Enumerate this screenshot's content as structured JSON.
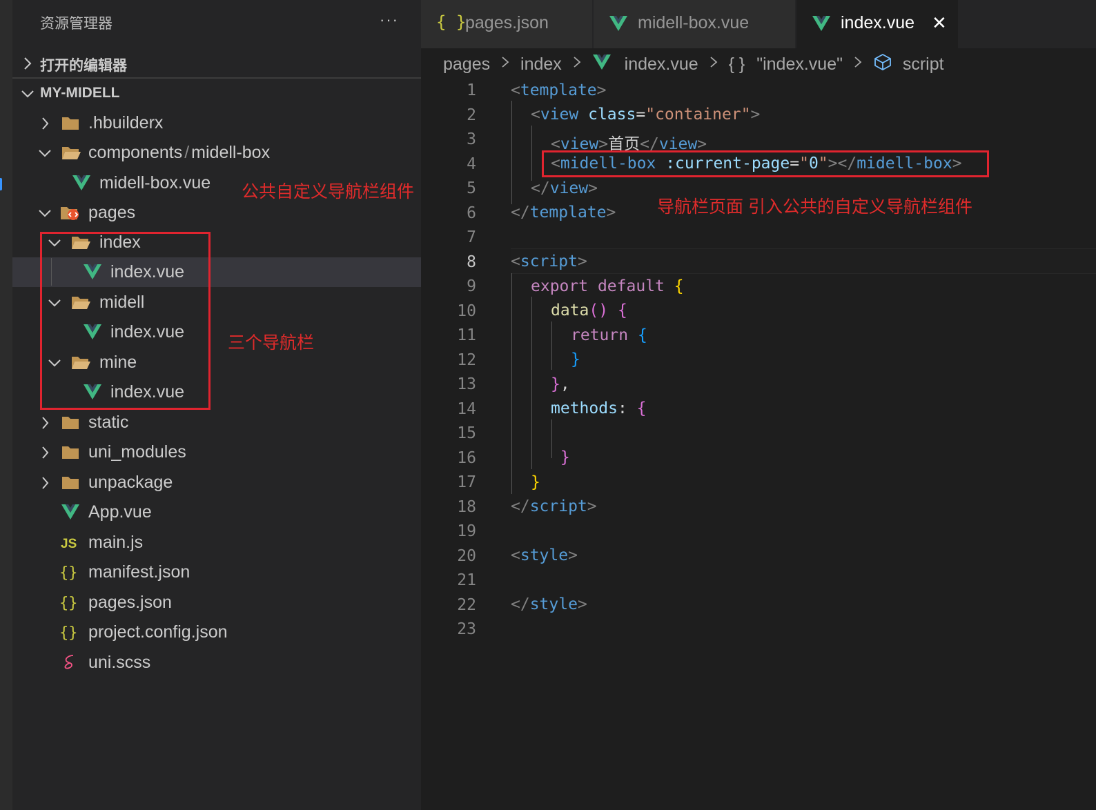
{
  "explorer": {
    "title": "资源管理器",
    "more": "···",
    "open_editors": "打开的编辑器",
    "project": "MY-MIDELL",
    "tree": [
      {
        "label": ".hbuilderx"
      },
      {
        "label": "components",
        "sep": "/",
        "label2": "midell-box"
      },
      {
        "label": "midell-box.vue"
      },
      {
        "label": "pages"
      },
      {
        "label": "index"
      },
      {
        "label": "index.vue"
      },
      {
        "label": "midell"
      },
      {
        "label": "index.vue"
      },
      {
        "label": "mine"
      },
      {
        "label": "index.vue"
      },
      {
        "label": "static"
      },
      {
        "label": "uni_modules"
      },
      {
        "label": "unpackage"
      },
      {
        "label": "App.vue"
      },
      {
        "label": "main.js"
      },
      {
        "label": "manifest.json"
      },
      {
        "label": "pages.json"
      },
      {
        "label": "project.config.json"
      },
      {
        "label": "uni.scss"
      }
    ]
  },
  "annotations": {
    "component": "公共自定义导航栏组件",
    "three_nav": "三个导航栏",
    "nav_page": "导航栏页面 引入公共的自定义导航栏组件"
  },
  "tabs": [
    {
      "label": "pages.json",
      "icon": "{ }"
    },
    {
      "label": "midell-box.vue",
      "icon": "V"
    },
    {
      "label": "index.vue",
      "icon": "V",
      "active": true,
      "close": "✕"
    }
  ],
  "breadcrumb": {
    "pages": "pages",
    "index": "index",
    "file": "index.vue",
    "obj_icon": "{ }",
    "obj": "\"index.vue\"",
    "script": "script"
  },
  "editor": {
    "current_line": 8,
    "line_numbers": [
      "1",
      "2",
      "3",
      "4",
      "5",
      "6",
      "7",
      "8",
      "9",
      "10",
      "11",
      "12",
      "13",
      "14",
      "15",
      "16",
      "17",
      "18",
      "19",
      "20",
      "21",
      "22",
      "23"
    ],
    "code": {
      "l3_text": "首页",
      "l4_value": "0"
    }
  },
  "colors": {
    "annotation_red": "#e0242f",
    "vue_green": "#41b883",
    "json_yellow": "#cbcb41"
  }
}
